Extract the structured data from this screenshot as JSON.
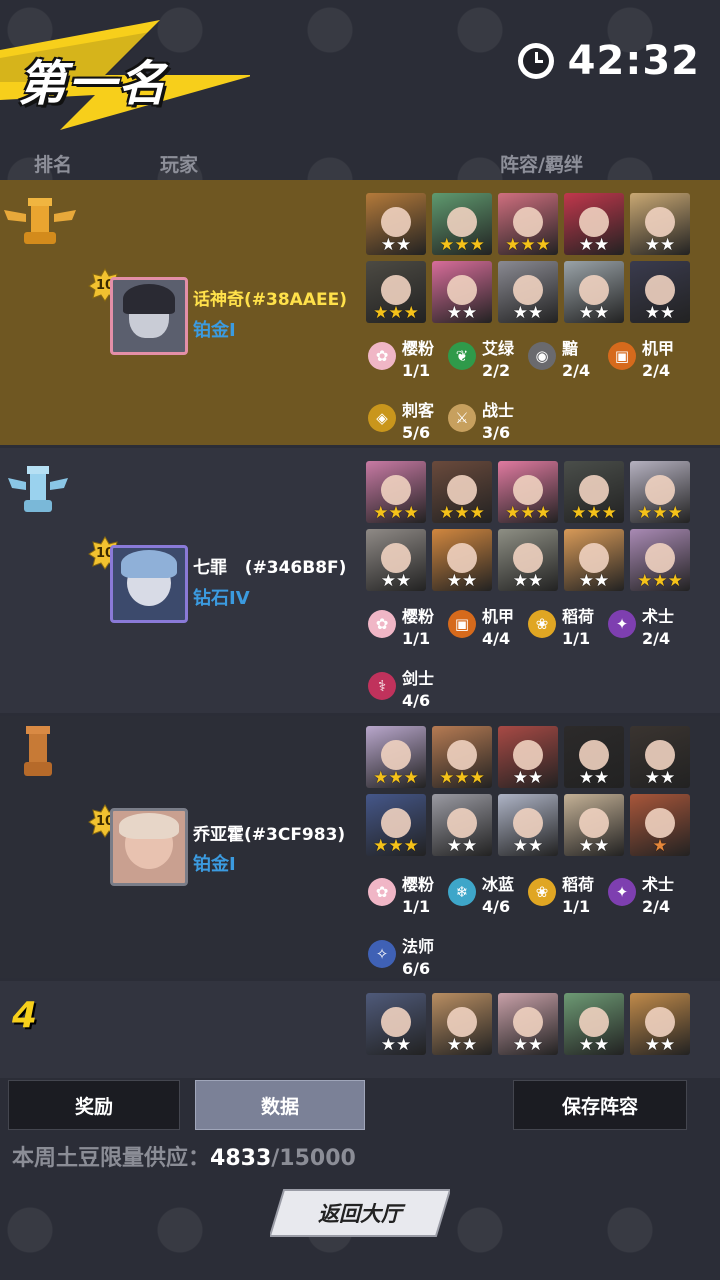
{
  "header": {
    "rank_title": "第一名",
    "timer": "42:32"
  },
  "columns": {
    "rank": "排名",
    "player": "玩家",
    "lineup": "阵容/羁绊"
  },
  "rows": [
    {
      "rank_icon": "gold-rook-wing-icon",
      "level": "10",
      "name": "话神奇(#38AAEE)",
      "tier": "铂金I",
      "heroes": [
        {
          "color": "#b47a3a",
          "stars": 2,
          "tier": "s"
        },
        {
          "color": "#5f9a6f",
          "stars": 3,
          "tier": "g"
        },
        {
          "color": "#d06f7f",
          "stars": 3,
          "tier": "g"
        },
        {
          "color": "#c1374c",
          "stars": 2,
          "tier": "s"
        },
        {
          "color": "#c9a873",
          "stars": 2,
          "tier": "s"
        },
        {
          "color": "#4c4a43",
          "stars": 3,
          "tier": "g"
        },
        {
          "color": "#d86d9a",
          "stars": 2,
          "tier": "s"
        },
        {
          "color": "#8a8a92",
          "stars": 2,
          "tier": "s"
        },
        {
          "color": "#9aa3a8",
          "stars": 2,
          "tier": "s"
        },
        {
          "color": "#3a3b4e",
          "stars": 2,
          "tier": "s"
        }
      ],
      "synergies": [
        {
          "icon": "sakura-icon",
          "bg": "#f0b6c6",
          "glyph": "✿",
          "name": "樱粉",
          "count": "1/1"
        },
        {
          "icon": "leaf-icon",
          "bg": "#2f9a4a",
          "glyph": "❦",
          "name": "艾绿",
          "count": "2/2"
        },
        {
          "icon": "eye-icon",
          "bg": "#6a6a6e",
          "glyph": "◉",
          "name": "黯",
          "count": "2/4"
        },
        {
          "icon": "robot-icon",
          "bg": "#d66a1c",
          "glyph": "▣",
          "name": "机甲",
          "count": "2/4"
        },
        {
          "icon": "assassin-icon",
          "bg": "#c9961c",
          "glyph": "◈",
          "name": "刺客",
          "count": "5/6"
        },
        {
          "icon": "warrior-icon",
          "bg": "#c7a05e",
          "glyph": "⚔",
          "name": "战士",
          "count": "3/6"
        }
      ]
    },
    {
      "rank_icon": "silver-rook-wing-icon",
      "level": "10",
      "name": "七罪   (#346B8F)",
      "tier": "钻石IV",
      "heroes": [
        {
          "color": "#c87aa4",
          "stars": 3,
          "tier": "g"
        },
        {
          "color": "#6a4a3c",
          "stars": 3,
          "tier": "g"
        },
        {
          "color": "#e07aa0",
          "stars": 3,
          "tier": "g"
        },
        {
          "color": "#4a4e4a",
          "stars": 3,
          "tier": "g"
        },
        {
          "color": "#b5b1c0",
          "stars": 3,
          "tier": "g"
        },
        {
          "color": "#8f8a86",
          "stars": 2,
          "tier": "s"
        },
        {
          "color": "#d1873f",
          "stars": 2,
          "tier": "s"
        },
        {
          "color": "#8e8f84",
          "stars": 2,
          "tier": "s"
        },
        {
          "color": "#d89a58",
          "stars": 2,
          "tier": "s"
        },
        {
          "color": "#a98ab4",
          "stars": 3,
          "tier": "g"
        }
      ],
      "synergies": [
        {
          "icon": "sakura-icon",
          "bg": "#f0b6c6",
          "glyph": "✿",
          "name": "樱粉",
          "count": "1/1"
        },
        {
          "icon": "robot-icon",
          "bg": "#d66a1c",
          "glyph": "▣",
          "name": "机甲",
          "count": "4/4"
        },
        {
          "icon": "wheat-icon",
          "bg": "#e0a623",
          "glyph": "❀",
          "name": "稻荷",
          "count": "1/1"
        },
        {
          "icon": "warlock-icon",
          "bg": "#7e3fb0",
          "glyph": "✦",
          "name": "术士",
          "count": "2/4"
        },
        {
          "icon": "swordsman-icon",
          "bg": "#c0325c",
          "glyph": "⚕",
          "name": "剑士",
          "count": "4/6"
        }
      ]
    },
    {
      "rank_icon": "bronze-rook-icon",
      "level": "10",
      "name": "乔亚霍(#3CF983)",
      "tier": "铂金I",
      "heroes": [
        {
          "color": "#b9a7cc",
          "stars": 3,
          "tier": "g"
        },
        {
          "color": "#b67b53",
          "stars": 3,
          "tier": "g"
        },
        {
          "color": "#a84a45",
          "stars": 2,
          "tier": "s"
        },
        {
          "color": "#2c2a2a",
          "stars": 2,
          "tier": "s"
        },
        {
          "color": "#3a3430",
          "stars": 2,
          "tier": "s"
        },
        {
          "color": "#45578a",
          "stars": 3,
          "tier": "g"
        },
        {
          "color": "#9a9aa2",
          "stars": 2,
          "tier": "s"
        },
        {
          "color": "#aeb4c6",
          "stars": 2,
          "tier": "s"
        },
        {
          "color": "#c4b196",
          "stars": 2,
          "tier": "s"
        },
        {
          "color": "#a8563a",
          "stars": 1,
          "tier": "b"
        }
      ],
      "synergies": [
        {
          "icon": "sakura-icon",
          "bg": "#f0b6c6",
          "glyph": "✿",
          "name": "樱粉",
          "count": "1/1"
        },
        {
          "icon": "snowflake-icon",
          "bg": "#3ea6c9",
          "glyph": "❄",
          "name": "冰蓝",
          "count": "4/6"
        },
        {
          "icon": "wheat-icon",
          "bg": "#e0a623",
          "glyph": "❀",
          "name": "稻荷",
          "count": "1/1"
        },
        {
          "icon": "warlock-icon",
          "bg": "#7e3fb0",
          "glyph": "✦",
          "name": "术士",
          "count": "2/4"
        },
        {
          "icon": "mage-icon",
          "bg": "#3f61b5",
          "glyph": "✧",
          "name": "法师",
          "count": "6/6"
        }
      ]
    },
    {
      "rank": "4",
      "heroes": [
        {
          "color": "#4f5a7a",
          "stars": 2,
          "tier": "s"
        },
        {
          "color": "#b98e62",
          "stars": 2,
          "tier": "s"
        },
        {
          "color": "#c8a0a8",
          "stars": 2,
          "tier": "s"
        },
        {
          "color": "#6d9a74",
          "stars": 2,
          "tier": "s"
        },
        {
          "color": "#c08a4a",
          "stars": 2,
          "tier": "s"
        }
      ]
    }
  ],
  "tabs": {
    "rewards": "奖励",
    "data": "数据",
    "save": "保存阵容"
  },
  "supply": {
    "label": "本周土豆限量供应：",
    "current": "4833",
    "total": "/15000"
  },
  "back_button": "返回大厅"
}
